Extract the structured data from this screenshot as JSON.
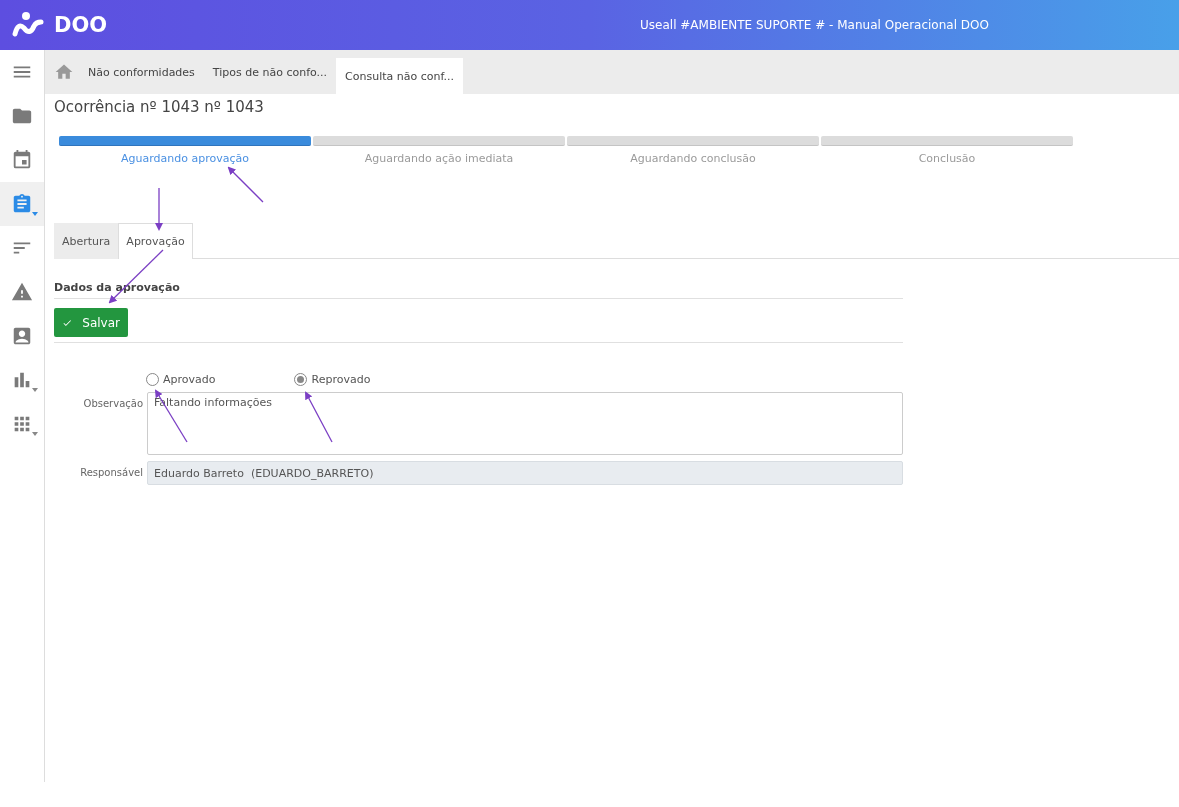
{
  "header": {
    "logo": "DOO",
    "title": "Useall #AMBIENTE SUPORTE # - Manual Operacional DOO"
  },
  "sidebar": {
    "items": [
      {
        "selected": false,
        "caret": false
      },
      {
        "selected": false,
        "caret": false
      },
      {
        "selected": true,
        "caret": true
      },
      {
        "selected": false,
        "caret": false
      },
      {
        "selected": false,
        "caret": false
      },
      {
        "selected": false,
        "caret": false
      },
      {
        "selected": false,
        "caret": true
      },
      {
        "selected": false,
        "caret": true
      }
    ]
  },
  "page_tabs": [
    {
      "label": "Não conformidades",
      "selected": false
    },
    {
      "label": "Tipos de não confo...",
      "selected": false
    },
    {
      "label": "Consulta não conf...",
      "selected": true
    }
  ],
  "page_title": "Ocorrência nº 1043 nº 1043",
  "steps": [
    {
      "label": "Aguardando aprovação",
      "selected": true
    },
    {
      "label": "Aguardando ação imediata",
      "selected": false
    },
    {
      "label": "Aguardando conclusão",
      "selected": false
    },
    {
      "label": "Conclusão",
      "selected": false
    }
  ],
  "form_tabs": [
    {
      "label": "Abertura",
      "selected": false
    },
    {
      "label": "Aprovação",
      "selected": true
    }
  ],
  "section_title": "Dados da aprovação",
  "save_button": "Salvar",
  "decision": [
    {
      "label": "Aprovado",
      "selected": false
    },
    {
      "label": "Reprovado",
      "selected": true
    }
  ],
  "fields": [
    {
      "label": "Observação",
      "kind": "textarea",
      "value": "Faltando informações"
    },
    {
      "label": "Responsável",
      "kind": "readonly",
      "value": "Eduardo Barreto  (EDUARDO_BARRETO)"
    }
  ]
}
